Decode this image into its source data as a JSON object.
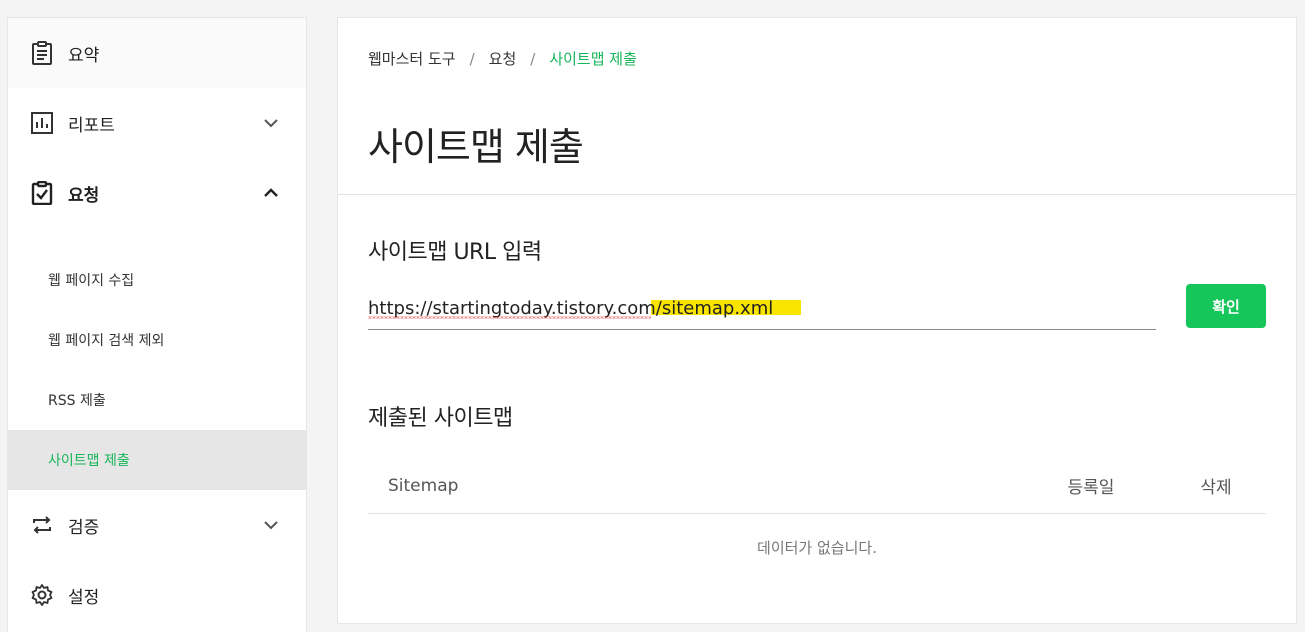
{
  "sidebar": {
    "summary": "요약",
    "report": "리포트",
    "request": "요청",
    "request_sub": [
      "웹 페이지 수집",
      "웹 페이지 검색 제외",
      "RSS 제출",
      "사이트맵 제출"
    ],
    "verify": "검증",
    "settings": "설정"
  },
  "breadcrumb": {
    "root": "웹마스터 도구",
    "sep": "/",
    "mid": "요청",
    "current": "사이트맵 제출"
  },
  "page_title": "사이트맵 제출",
  "url_section": {
    "title": "사이트맵 URL 입력",
    "input_value": "https://startingtoday.tistory.com/sitemap.xml",
    "confirm_label": "확인"
  },
  "submitted_section": {
    "title": "제출된 사이트맵",
    "columns": [
      "Sitemap",
      "등록일",
      "삭제"
    ],
    "empty_message": "데이터가 없습니다."
  },
  "colors": {
    "accent": "#16c65a",
    "active_text": "#16b55a",
    "highlight": "#fae500"
  }
}
